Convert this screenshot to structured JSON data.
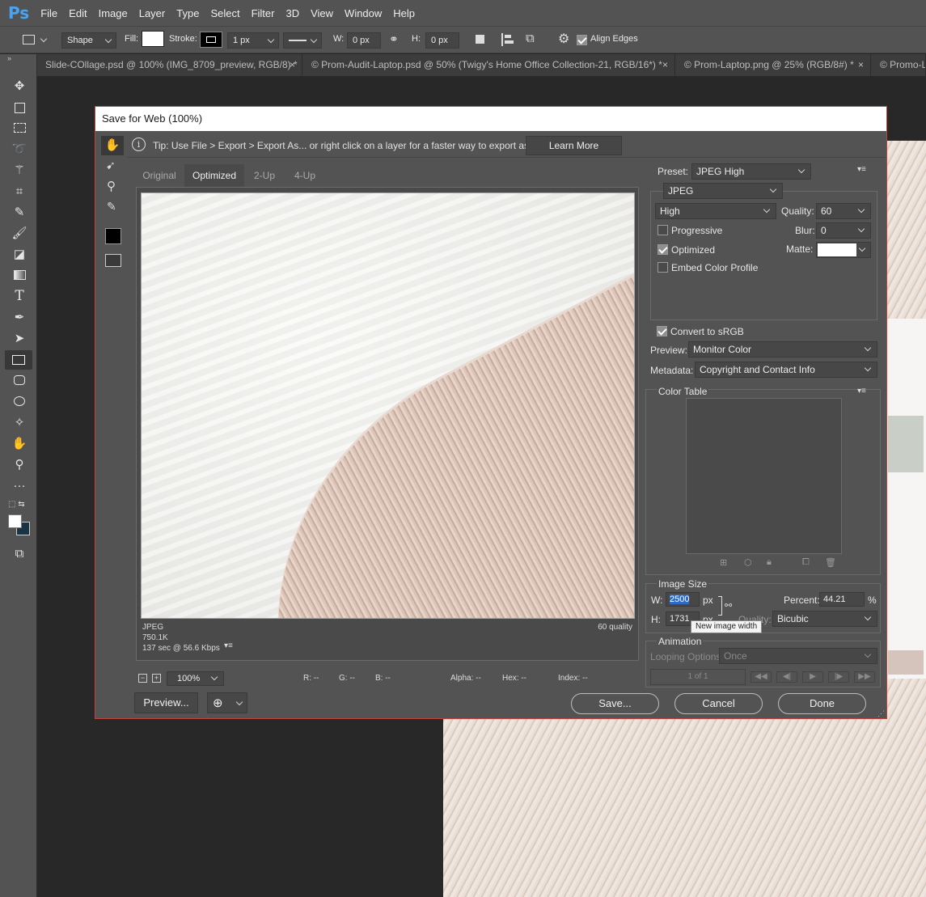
{
  "app": {
    "logo": "Ps"
  },
  "menu": [
    "File",
    "Edit",
    "Image",
    "Layer",
    "Type",
    "Select",
    "Filter",
    "3D",
    "View",
    "Window",
    "Help"
  ],
  "options_bar": {
    "mode": "Shape",
    "fill_label": "Fill:",
    "stroke_label": "Stroke:",
    "stroke_width": "1 px",
    "w_label": "W:",
    "w_value": "0 px",
    "h_label": "H:",
    "h_value": "0 px",
    "align_edges": "Align Edges"
  },
  "tabs": [
    "Slide-COllage.psd @ 100% (IMG_8709_preview, RGB/8) *",
    "© Prom-Audit-Laptop.psd @ 50% (Twigy's Home Office Collection-21, RGB/16*) *",
    "© Prom-Laptop.png @ 25% (RGB/8#) *",
    "© Promo-L"
  ],
  "dialog": {
    "title": "Save for Web (100%)",
    "tip": "Tip: Use File > Export > Export As...  or right click on a layer for a faster way to export assets",
    "learn_more": "Learn More",
    "view_tabs": [
      "Original",
      "Optimized",
      "2-Up",
      "4-Up"
    ],
    "image_info": {
      "format": "JPEG",
      "size": "750.1K",
      "time": "137 sec @ 56.6 Kbps",
      "quality": "60 quality"
    },
    "zoom": "100%",
    "readouts": {
      "r": "R: --",
      "g": "G: --",
      "b": "B: --",
      "alpha": "Alpha: --",
      "hex": "Hex: --",
      "index": "Index: --"
    },
    "preview_btn": "Preview...",
    "save_btn": "Save...",
    "cancel_btn": "Cancel",
    "done_btn": "Done"
  },
  "settings": {
    "preset_label": "Preset:",
    "preset": "JPEG High",
    "format": "JPEG",
    "compression": "High",
    "quality_label": "Quality:",
    "quality": "60",
    "progressive": "Progressive",
    "blur_label": "Blur:",
    "blur": "0",
    "optimized": "Optimized",
    "matte_label": "Matte:",
    "embed_profile": "Embed Color Profile",
    "convert_srgb": "Convert to sRGB",
    "preview_label": "Preview:",
    "preview": "Monitor Color",
    "metadata_label": "Metadata:",
    "metadata": "Copyright and Contact Info",
    "color_table": "Color Table",
    "image_size": "Image Size",
    "w_label": "W:",
    "w": "2500",
    "h_label": "H:",
    "h": "1731",
    "px": "px",
    "percent_label": "Percent:",
    "percent": "44.21",
    "percent_unit": "%",
    "quality2_label": "Quality:",
    "resample": "Bicubic",
    "tooltip": "New image width",
    "animation": "Animation",
    "looping_label": "Looping Options:",
    "looping": "Once",
    "frame": "1 of 1"
  },
  "checkboxes": {
    "progressive": false,
    "optimized": true,
    "embed": false,
    "srgb": true,
    "align_edges": true
  },
  "colors": {
    "accent": "#4aa3f2",
    "dialog_border": "#c0423b",
    "selection": "#2d6bc4"
  }
}
